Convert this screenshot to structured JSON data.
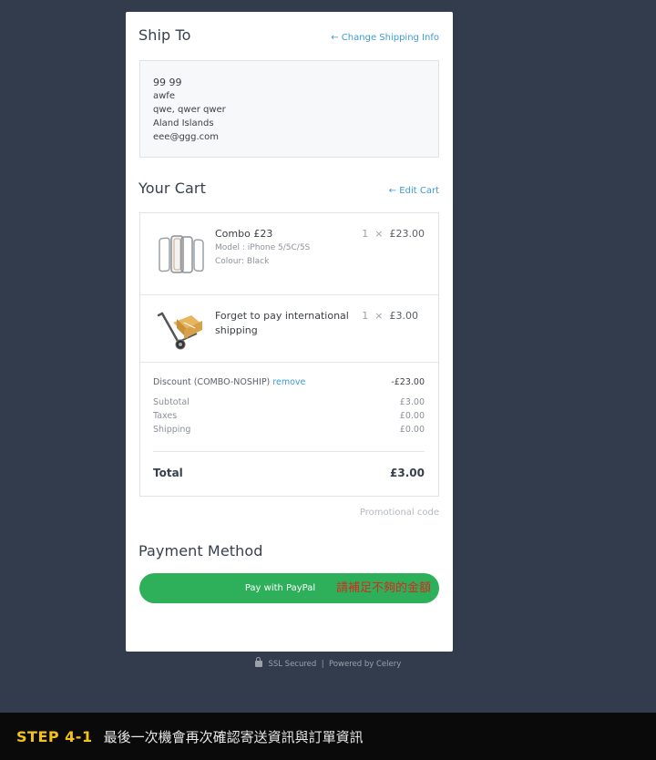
{
  "ship_to": {
    "title": "Ship To",
    "change_link": "← Change Shipping Info",
    "address": {
      "name": "99 99",
      "line1": "awfe",
      "line2": "qwe, qwer qwer",
      "line3": "Aland Islands",
      "email": "eee@ggg.com"
    }
  },
  "cart": {
    "title": "Your Cart",
    "edit_link": "← Edit Cart",
    "items": [
      {
        "title": "Combo £23",
        "model": "Model : iPhone 5/5C/5S",
        "colour": "Colour: Black",
        "qty": "1",
        "times": "×",
        "price": "£23.00",
        "icon": "phone-case-icon"
      },
      {
        "title": "Forget to pay international shipping",
        "qty": "1",
        "times": "×",
        "price": "£3.00",
        "icon": "hand-truck-box-icon"
      }
    ],
    "discount_label": "Discount (COMBO-NOSHIP)",
    "discount_remove": "remove",
    "discount_value": "-£23.00",
    "subtotal_label": "Subtotal",
    "subtotal_value": "£3.00",
    "taxes_label": "Taxes",
    "taxes_value": "£0.00",
    "shipping_label": "Shipping",
    "shipping_value": "£0.00",
    "total_label": "Total",
    "total_value": "£3.00"
  },
  "promo_link": "Promotional code",
  "payment": {
    "title": "Payment Method",
    "paypal_label": "Pay with PayPal",
    "button_color": "#2eb05a"
  },
  "annotation": "請補足不夠的金額",
  "footer": {
    "secured": "SSL Secured",
    "divider": "|",
    "powered": "Powered by Celery"
  },
  "banner": {
    "step": "STEP 4-1",
    "desc": "最後一次機會再次確認寄送資訊與訂單資訊"
  },
  "colors": {
    "page_bg": "#333c4c",
    "link": "#3d9bd4",
    "step_label": "#f3c21a",
    "annotation": "#d42a21"
  }
}
